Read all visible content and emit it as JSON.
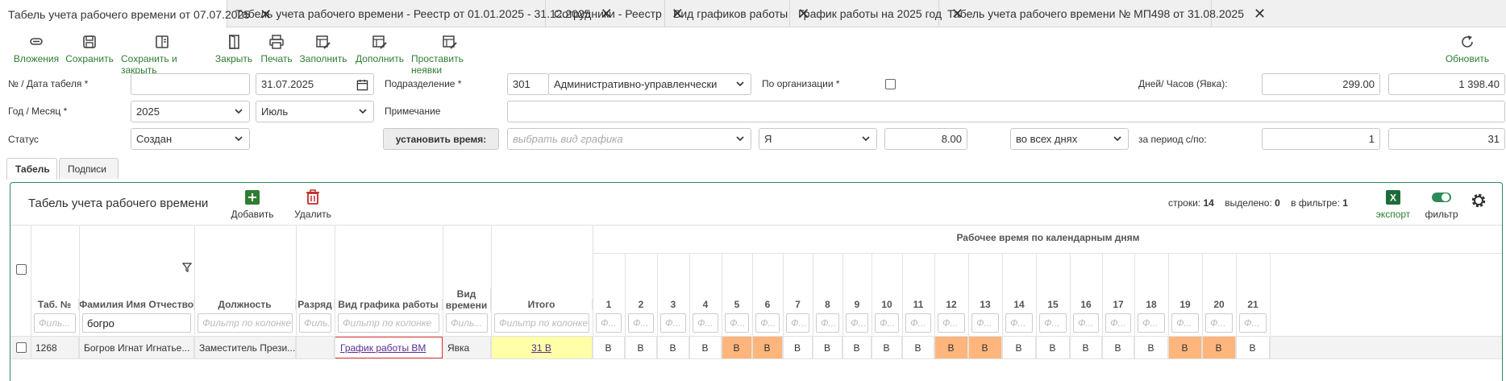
{
  "tabs": [
    {
      "label": "Табель учета рабочего времени от 07.07.2025",
      "active": true
    },
    {
      "label": "Табель учета рабочего времени - Реестр от 01.01.2025 - 31.12.2025",
      "active": false
    },
    {
      "label": "Сотрудники - Реестр",
      "active": false
    },
    {
      "label": "Вид графиков работы",
      "active": false
    },
    {
      "label": "График работы на 2025 год",
      "active": false
    },
    {
      "label": "Табель учета рабочего времени № МП498 от 31.08.2025",
      "active": false
    }
  ],
  "toolbar": {
    "attachments": "Вложения",
    "save": "Сохранить",
    "save_close": "Сохранить и закрыть",
    "close": "Закрыть",
    "print": "Печать",
    "fill": "Заполнить",
    "append": "Дополнить",
    "absences": "Проставить неявки",
    "refresh": "Обновить"
  },
  "form": {
    "num_date_label": "№ / Дата табеля *",
    "num_value": "",
    "date_value": "31.07.2025",
    "year_month_label": "Год / Месяц *",
    "year_value": "2025",
    "month_value": "Июль",
    "status_label": "Статус",
    "status_value": "Создан",
    "division_label": "Подразделение *",
    "division_code": "301",
    "division_name": "Административно-управленчески",
    "by_org_label": "По организации *",
    "note_label": "Примечание",
    "note_value": "",
    "set_time_button": "установить время:",
    "schedule_placeholder": "выбрать вид графика",
    "time_kind_value": "Я",
    "hours_value": "8.00",
    "days_mode_value": "во всех днях",
    "days_hours_label": "Дней/ Часов (Явка):",
    "days_value": "299.00",
    "hours_total_value": "1 398.40",
    "period_label": "за период с/по:",
    "period_from": "1",
    "period_to": "31"
  },
  "inner_tabs": [
    "Табель",
    "Подписи"
  ],
  "panel": {
    "title": "Табель учета рабочего времени",
    "add": "Добавить",
    "delete": "Удалить",
    "rows_label": "строки:",
    "rows_value": "14",
    "selected_label": "выделено:",
    "selected_value": "0",
    "in_filter_label": "в фильтре:",
    "in_filter_value": "1",
    "export": "экспорт",
    "filter": "фильтр"
  },
  "table": {
    "group_header": "Рабочее время по календарным дням",
    "columns": {
      "tab_no": "Таб. №",
      "fio": "Фамилия Имя Отчество",
      "position": "Должность",
      "rank": "Разряд",
      "schedule": "Вид графика работы",
      "time_kind": "Вид времени",
      "total": "Итого"
    },
    "filter_placeholder": "Фильтр по колонке",
    "filter_short": "Филь...",
    "filter_day": "Ф...",
    "fio_filter_value": "богро",
    "days": [
      "1",
      "2",
      "3",
      "4",
      "5",
      "6",
      "7",
      "8",
      "9",
      "10",
      "11",
      "12",
      "13",
      "14",
      "15",
      "16",
      "17",
      "18",
      "19",
      "20",
      "21"
    ],
    "row": {
      "tab_no": "1268",
      "fio": "Богров Игнат Игнатье...",
      "position": "Заместитель Прези...",
      "rank": "",
      "schedule": "График работы ВМ",
      "time_kind": "Явка",
      "total": "31 В",
      "day_values": [
        "В",
        "В",
        "В",
        "В",
        "В",
        "В",
        "В",
        "В",
        "В",
        "В",
        "В",
        "В",
        "В",
        "В",
        "В",
        "В",
        "В",
        "В",
        "В",
        "В",
        "В"
      ],
      "weekend_days": [
        5,
        6,
        12,
        13,
        19,
        20
      ]
    }
  },
  "colors": {
    "accent_green": "#2e7d32",
    "weekend": "#ffb57c",
    "total_bg": "#ffffa8",
    "delete_red": "#c62828"
  }
}
